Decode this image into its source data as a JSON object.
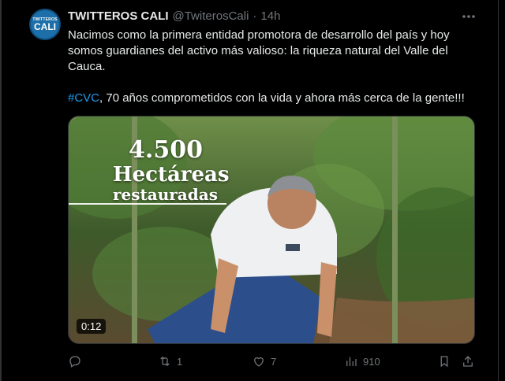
{
  "tweet": {
    "avatar": {
      "line1": "TWITTEROS",
      "line2": "CALI"
    },
    "display_name": "TWITTEROS CALI",
    "handle": "@TwiterosCali",
    "separator": "·",
    "time": "14h",
    "more_icon": "more-icon",
    "text_para1": "Nacimos como la primera entidad promotora de desarrollo del país y hoy somos guardianes del activo más valioso: la riqueza natural del Valle del Cauca.",
    "hashtag": "#CVC",
    "text_para2_rest": ", 70 años comprometidos con la vida y ahora más cerca de la gente!!!",
    "video": {
      "overlay_number": "4.500",
      "overlay_line2": "Hectáreas",
      "overlay_line3": "restauradas",
      "duration": "0:12"
    },
    "actions": {
      "reply_count": "",
      "retweet_count": "1",
      "like_count": "7",
      "views_count": "910"
    }
  },
  "colors": {
    "background": "#000000",
    "text": "#e7e9ea",
    "muted": "#71767b",
    "link": "#1d9bf0"
  }
}
